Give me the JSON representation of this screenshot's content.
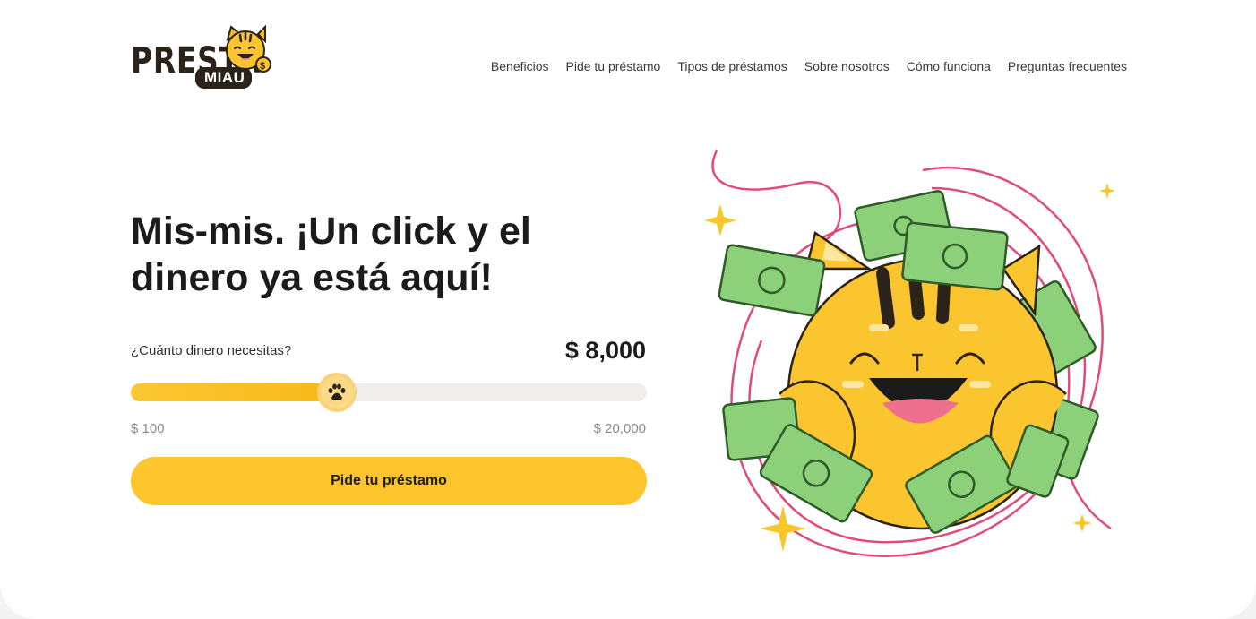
{
  "brand": {
    "logo_word": "PRESTA",
    "logo_badge": "MIAU",
    "logo_icon": "cat-coin-icon"
  },
  "nav": {
    "items": [
      {
        "label": "Beneficios"
      },
      {
        "label": "Pide tu préstamo"
      },
      {
        "label": "Tipos de préstamos"
      },
      {
        "label": "Sobre nosotros"
      },
      {
        "label": "Cómo funciona"
      },
      {
        "label": "Preguntas frecuentes"
      }
    ]
  },
  "hero": {
    "title": "Mis-mis. ¡Un click y el dinero ya está aquí!",
    "question": "¿Cuánto dinero necesitas?",
    "amount_display": "$ 8,000",
    "slider": {
      "min_label": "$ 100",
      "max_label": "$ 20,000",
      "min": 100,
      "max": 20000,
      "value": 8000,
      "thumb_icon": "paw-icon"
    },
    "cta_label": "Pide tu préstamo",
    "illustration": "happy-cat-with-money-icon"
  },
  "colors": {
    "accent": "#fec62c",
    "slider_fill": "#f6b91a",
    "track": "#efeeed",
    "text_dark": "#1b1b1b",
    "muted": "#8a8a8a",
    "swirl": "#e24a7a",
    "money_green": "#8cd07a"
  }
}
